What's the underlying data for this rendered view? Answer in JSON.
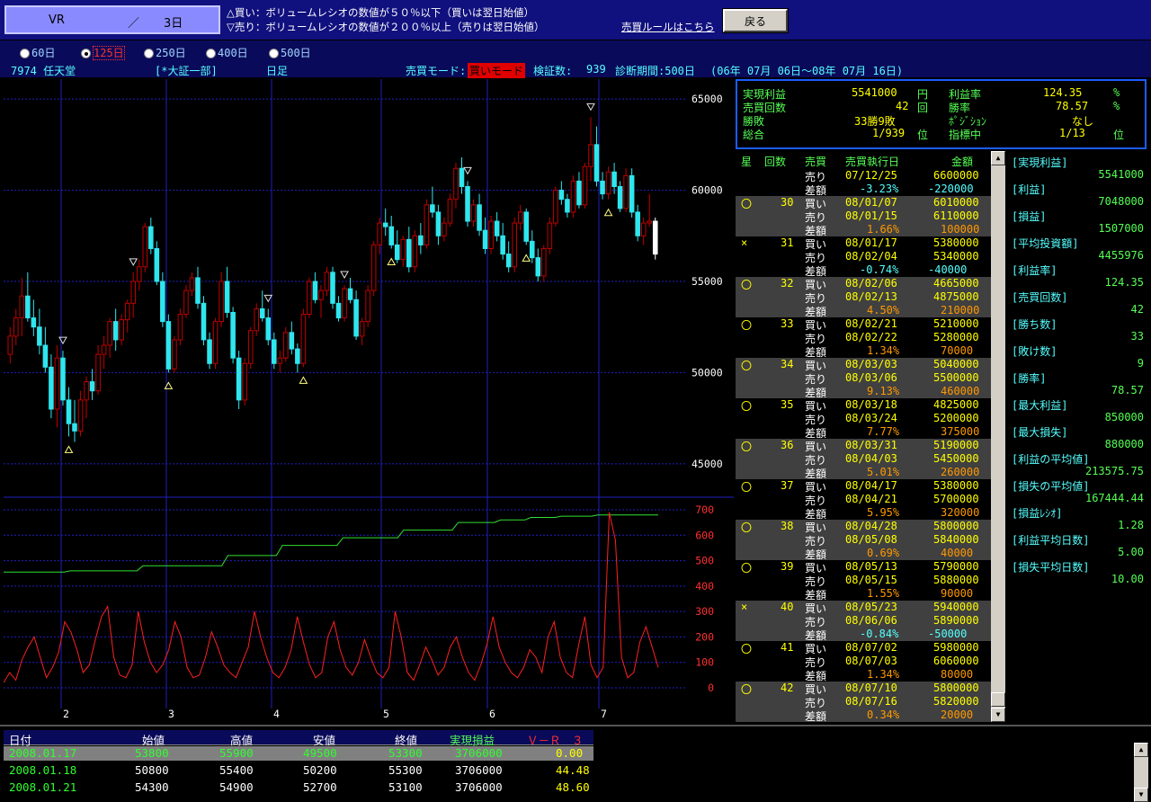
{
  "header": {
    "indicator": "VR",
    "slash": "／",
    "days": "3日",
    "buy_rule": "△買い：ボリュームレシオの数値が５０％以下（買いは翌日始値）",
    "sell_rule": "▽売り：ボリュームレシオの数値が２００％以上（売りは翌日始値）",
    "rules_link": "売買ルールはこちら",
    "back_label": "戻る"
  },
  "periods": [
    {
      "label": "60日",
      "selected": false
    },
    {
      "label": "125日",
      "selected": true
    },
    {
      "label": "250日",
      "selected": false
    },
    {
      "label": "400日",
      "selected": false
    },
    {
      "label": "500日",
      "selected": false
    }
  ],
  "stock": {
    "code_name": "7974 任天堂",
    "market": "[*大証一部]",
    "timeframe": "日足",
    "mode_label": "売買モード:",
    "mode_value": "買いモード",
    "verified_label": "検証数:",
    "verified_value": "939",
    "period_label": "診断期間:500日",
    "period_range": "(06年 07月 06日～08年 07月 16日)"
  },
  "summary": {
    "realized_label": "実現利益",
    "realized_value": "5541000",
    "realized_unit": "円",
    "trades_label": "売買回数",
    "trades_value": "42",
    "trades_unit": "回",
    "winloss_label": "勝敗",
    "winloss_value": "33勝9敗",
    "total_label": "総合",
    "total_value": "1/939",
    "total_unit": "位",
    "profit_rate_label": "利益率",
    "profit_rate_value": "124.35",
    "profit_rate_unit": "%",
    "win_rate_label": "勝率",
    "win_rate_value": "78.57",
    "win_rate_unit": "%",
    "position_label": "ﾎﾟｼﾞｼｮﾝ",
    "position_value": "なし",
    "indicator_label": "指標中",
    "indicator_value": "1/13",
    "indicator_unit": "位"
  },
  "trade_headers": [
    "星",
    "回数",
    "売買",
    "売買執行日",
    "金額"
  ],
  "trades_top": [
    {
      "side": "売り",
      "date": "07/12/25",
      "amount": "6600000"
    },
    {
      "side": "差額",
      "date": "-3.23%",
      "amount": "-220000"
    }
  ],
  "trades": [
    {
      "mark": "〇",
      "no": "30",
      "buy_date": "08/01/07",
      "buy_amt": "6010000",
      "sell_date": "08/01/15",
      "sell_amt": "6110000",
      "pct": "1.66%",
      "diff": "100000",
      "neg": false
    },
    {
      "mark": "×",
      "no": "31",
      "buy_date": "08/01/17",
      "buy_amt": "5380000",
      "sell_date": "08/02/04",
      "sell_amt": "5340000",
      "pct": "-0.74%",
      "diff": "-40000",
      "neg": true
    },
    {
      "mark": "〇",
      "no": "32",
      "buy_date": "08/02/06",
      "buy_amt": "4665000",
      "sell_date": "08/02/13",
      "sell_amt": "4875000",
      "pct": "4.50%",
      "diff": "210000",
      "neg": false
    },
    {
      "mark": "〇",
      "no": "33",
      "buy_date": "08/02/21",
      "buy_amt": "5210000",
      "sell_date": "08/02/22",
      "sell_amt": "5280000",
      "pct": "1.34%",
      "diff": "70000",
      "neg": false
    },
    {
      "mark": "〇",
      "no": "34",
      "buy_date": "08/03/03",
      "buy_amt": "5040000",
      "sell_date": "08/03/06",
      "sell_amt": "5500000",
      "pct": "9.13%",
      "diff": "460000",
      "neg": false
    },
    {
      "mark": "〇",
      "no": "35",
      "buy_date": "08/03/18",
      "buy_amt": "4825000",
      "sell_date": "08/03/24",
      "sell_amt": "5200000",
      "pct": "7.77%",
      "diff": "375000",
      "neg": false
    },
    {
      "mark": "〇",
      "no": "36",
      "buy_date": "08/03/31",
      "buy_amt": "5190000",
      "sell_date": "08/04/03",
      "sell_amt": "5450000",
      "pct": "5.01%",
      "diff": "260000",
      "neg": false
    },
    {
      "mark": "〇",
      "no": "37",
      "buy_date": "08/04/17",
      "buy_amt": "5380000",
      "sell_date": "08/04/21",
      "sell_amt": "5700000",
      "pct": "5.95%",
      "diff": "320000",
      "neg": false
    },
    {
      "mark": "〇",
      "no": "38",
      "buy_date": "08/04/28",
      "buy_amt": "5800000",
      "sell_date": "08/05/08",
      "sell_amt": "5840000",
      "pct": "0.69%",
      "diff": "40000",
      "neg": false
    },
    {
      "mark": "〇",
      "no": "39",
      "buy_date": "08/05/13",
      "buy_amt": "5790000",
      "sell_date": "08/05/15",
      "sell_amt": "5880000",
      "pct": "1.55%",
      "diff": "90000",
      "neg": false
    },
    {
      "mark": "×",
      "no": "40",
      "buy_date": "08/05/23",
      "buy_amt": "5940000",
      "sell_date": "08/06/06",
      "sell_amt": "5890000",
      "pct": "-0.84%",
      "diff": "-50000",
      "neg": true
    },
    {
      "mark": "〇",
      "no": "41",
      "buy_date": "08/07/02",
      "buy_amt": "5980000",
      "sell_date": "08/07/03",
      "sell_amt": "6060000",
      "pct": "1.34%",
      "diff": "80000",
      "neg": false
    },
    {
      "mark": "〇",
      "no": "42",
      "buy_date": "08/07/10",
      "buy_amt": "5800000",
      "sell_date": "08/07/16",
      "sell_amt": "5820000",
      "pct": "0.34%",
      "diff": "20000",
      "neg": false
    }
  ],
  "trade_words": {
    "buy": "買い",
    "sell": "売り",
    "diff": "差額"
  },
  "stats": [
    {
      "label": "[実現利益]",
      "value": "5541000"
    },
    {
      "label": "[利益]",
      "value": "7048000"
    },
    {
      "label": "[損益]",
      "value": "1507000"
    },
    {
      "label": "[平均投資額]",
      "value": "4455976"
    },
    {
      "label": "[利益率]",
      "value": "124.35"
    },
    {
      "label": "[売買回数]",
      "value": "42"
    },
    {
      "label": "[勝ち数]",
      "value": "33"
    },
    {
      "label": "[敗け数]",
      "value": "9"
    },
    {
      "label": "[勝率]",
      "value": "78.57"
    },
    {
      "label": "[最大利益]",
      "value": "850000"
    },
    {
      "label": "[最大損失]",
      "value": "880000"
    },
    {
      "label": "[利益の平均値]",
      "value": "213575.75"
    },
    {
      "label": "[損失の平均値]",
      "value": "167444.44"
    },
    {
      "label": "[損益ﾚｼｵ]",
      "value": "1.28"
    },
    {
      "label": "[利益平均日数]",
      "value": "5.00"
    },
    {
      "label": "[損失平均日数]",
      "value": "10.00"
    }
  ],
  "bottom": {
    "headers": [
      "日付",
      "始値",
      "高値",
      "安値",
      "終値",
      "実現損益",
      "Ｖ－Ｒ　３"
    ],
    "rows": [
      [
        "2008.01.17",
        "53800",
        "55900",
        "49500",
        "53300",
        "3706000",
        "0.00"
      ],
      [
        "2008.01.18",
        "50800",
        "55400",
        "50200",
        "55300",
        "3706000",
        "44.48"
      ],
      [
        "2008.01.21",
        "54300",
        "54900",
        "52700",
        "53100",
        "3706000",
        "48.60"
      ]
    ]
  },
  "colors": {
    "up": "#c00000",
    "down": "#2ee6ee",
    "grid": "#2020c0",
    "vr_line": "#ff2020",
    "profit_line": "#30e030",
    "label_green": "#55ff55",
    "label_cyan": "#55ffff",
    "diff_orange": "#ff9900",
    "neg_cyan": "#55ffff"
  },
  "chart_data": {
    "type": "candlestick+line",
    "price_axis": {
      "ticks": [
        "65000",
        "60000",
        "55000",
        "50000",
        "45000"
      ],
      "ylim": [
        44500,
        65500
      ]
    },
    "vr_axis": {
      "ticks": [
        "700",
        "600",
        "500",
        "400",
        "300",
        "200",
        "100",
        "0"
      ],
      "ylim": [
        0,
        700
      ]
    },
    "x_ticks": [
      "2",
      "3",
      "4",
      "5",
      "6",
      "7"
    ],
    "candles_ohlc": [
      [
        51000,
        52500,
        50500,
        52000
      ],
      [
        52000,
        53500,
        51500,
        53000
      ],
      [
        53000,
        55200,
        52000,
        54200
      ],
      [
        54200,
        55500,
        52800,
        53000
      ],
      [
        53000,
        54000,
        52000,
        52500
      ],
      [
        52500,
        53500,
        51000,
        51500
      ],
      [
        51500,
        52500,
        50000,
        50300
      ],
      [
        50300,
        51000,
        47500,
        48000
      ],
      [
        48000,
        51500,
        47000,
        50800
      ],
      [
        50800,
        51200,
        48200,
        48500
      ],
      [
        48500,
        49200,
        46500,
        47200
      ],
      [
        47200,
        48500,
        46200,
        46800
      ],
      [
        46800,
        49000,
        46500,
        48500
      ],
      [
        48500,
        49800,
        47500,
        49500
      ],
      [
        49500,
        50200,
        48500,
        49000
      ],
      [
        49000,
        51500,
        48800,
        51000
      ],
      [
        51000,
        52000,
        50200,
        51500
      ],
      [
        51500,
        53000,
        50800,
        52800
      ],
      [
        52800,
        53500,
        51200,
        51800
      ],
      [
        51800,
        53200,
        51500,
        52900
      ],
      [
        52900,
        54000,
        52200,
        53800
      ],
      [
        53800,
        55500,
        53000,
        55000
      ],
      [
        55000,
        56200,
        54500,
        55800
      ],
      [
        55800,
        58200,
        55500,
        58000
      ],
      [
        58000,
        58500,
        56500,
        56800
      ],
      [
        56800,
        57200,
        54800,
        55000
      ],
      [
        55000,
        55500,
        52500,
        52800
      ],
      [
        52800,
        53200,
        50000,
        50200
      ],
      [
        50200,
        52000,
        50000,
        51800
      ],
      [
        51800,
        53500,
        51500,
        53200
      ],
      [
        53200,
        54800,
        53000,
        54500
      ],
      [
        54500,
        55500,
        54200,
        55200
      ],
      [
        55200,
        55800,
        53500,
        53800
      ],
      [
        53800,
        54200,
        51500,
        51800
      ],
      [
        51800,
        52200,
        50200,
        50500
      ],
      [
        50500,
        53000,
        50200,
        52800
      ],
      [
        52800,
        55500,
        52500,
        55000
      ],
      [
        55000,
        55800,
        53000,
        53300
      ],
      [
        53300,
        53600,
        50500,
        50800
      ],
      [
        50800,
        51200,
        48000,
        48500
      ],
      [
        48500,
        50800,
        48200,
        50500
      ],
      [
        50500,
        52500,
        50200,
        52300
      ],
      [
        52300,
        53800,
        52000,
        53500
      ],
      [
        53500,
        54500,
        52800,
        53000
      ],
      [
        53000,
        53500,
        51500,
        51800
      ],
      [
        51800,
        52200,
        50200,
        50500
      ],
      [
        50500,
        51200,
        50000,
        50800
      ],
      [
        50800,
        52500,
        50600,
        52200
      ],
      [
        52200,
        52800,
        51000,
        51300
      ],
      [
        51300,
        51600,
        50000,
        50500
      ],
      [
        50500,
        53500,
        50300,
        53200
      ],
      [
        53200,
        55200,
        53000,
        55000
      ],
      [
        55000,
        55500,
        53800,
        54000
      ],
      [
        54000,
        54800,
        53000,
        54500
      ],
      [
        54500,
        55800,
        54200,
        55500
      ],
      [
        55500,
        55800,
        53500,
        53800
      ],
      [
        53800,
        54200,
        52800,
        53000
      ],
      [
        53000,
        54800,
        52800,
        54600
      ],
      [
        54600,
        55200,
        53800,
        54000
      ],
      [
        54000,
        54500,
        51800,
        52000
      ],
      [
        52000,
        53000,
        51500,
        52800
      ],
      [
        52800,
        54800,
        52500,
        54500
      ],
      [
        54500,
        57200,
        54200,
        57000
      ],
      [
        57000,
        58500,
        56500,
        58200
      ],
      [
        58200,
        59000,
        57500,
        58000
      ],
      [
        58000,
        58600,
        56800,
        57000
      ],
      [
        57000,
        57800,
        56000,
        56200
      ],
      [
        56200,
        57500,
        55800,
        57300
      ],
      [
        57300,
        58000,
        55500,
        55800
      ],
      [
        55800,
        57800,
        55500,
        57500
      ],
      [
        57500,
        58200,
        56500,
        57000
      ],
      [
        57000,
        59500,
        56800,
        59200
      ],
      [
        59200,
        60200,
        58500,
        58800
      ],
      [
        58800,
        59200,
        57000,
        57500
      ],
      [
        57500,
        58500,
        57200,
        58200
      ],
      [
        58200,
        59800,
        58000,
        59500
      ],
      [
        59500,
        61500,
        59000,
        61200
      ],
      [
        61200,
        61800,
        59800,
        60200
      ],
      [
        60200,
        60500,
        58000,
        58300
      ],
      [
        58300,
        59500,
        58000,
        59200
      ],
      [
        59200,
        59800,
        57500,
        57800
      ],
      [
        57800,
        58500,
        56500,
        56800
      ],
      [
        56800,
        58600,
        56500,
        58300
      ],
      [
        58300,
        58800,
        57200,
        57500
      ],
      [
        57500,
        58200,
        56200,
        56500
      ],
      [
        56500,
        57200,
        55500,
        55800
      ],
      [
        55800,
        58500,
        55500,
        58200
      ],
      [
        58200,
        59200,
        57800,
        58800
      ],
      [
        58800,
        59000,
        57000,
        57200
      ],
      [
        57200,
        57800,
        56000,
        56300
      ],
      [
        56300,
        56800,
        55000,
        55300
      ],
      [
        55300,
        57000,
        55000,
        56800
      ],
      [
        56800,
        58500,
        56500,
        58200
      ],
      [
        58200,
        60200,
        58000,
        60000
      ],
      [
        60000,
        60500,
        59200,
        59500
      ],
      [
        59500,
        59800,
        58500,
        58800
      ],
      [
        58800,
        60800,
        58500,
        60500
      ],
      [
        60500,
        61000,
        59000,
        59200
      ],
      [
        59200,
        61500,
        59000,
        61300
      ],
      [
        61300,
        64000,
        60500,
        62500
      ],
      [
        62500,
        63500,
        60200,
        60500
      ],
      [
        60500,
        61000,
        59500,
        59800
      ],
      [
        59800,
        61300,
        59500,
        61000
      ],
      [
        61000,
        61500,
        59800,
        60200
      ],
      [
        60200,
        60500,
        58800,
        59000
      ],
      [
        59000,
        61200,
        58800,
        60800
      ],
      [
        60800,
        61200,
        58500,
        58800
      ],
      [
        58800,
        59200,
        57200,
        57500
      ],
      [
        57500,
        58500,
        57000,
        58200
      ],
      [
        58200,
        59800,
        58000,
        58300
      ],
      [
        58300,
        58500,
        56200,
        56500
      ]
    ],
    "buy_signals_idx": [
      10,
      27,
      50,
      65,
      88,
      102
    ],
    "sell_signals_idx": [
      9,
      21,
      44,
      57,
      78,
      99
    ],
    "vr_values": [
      20,
      60,
      30,
      110,
      160,
      200,
      120,
      40,
      80,
      140,
      260,
      220,
      150,
      60,
      90,
      190,
      280,
      320,
      120,
      50,
      40,
      90,
      300,
      180,
      100,
      60,
      90,
      150,
      260,
      200,
      80,
      40,
      50,
      120,
      220,
      160,
      90,
      60,
      40,
      100,
      160,
      300,
      200,
      120,
      60,
      40,
      80,
      150,
      280,
      180,
      90,
      40,
      60,
      200,
      260,
      150,
      80,
      50,
      100,
      190,
      120,
      60,
      40,
      80,
      300,
      200,
      60,
      30,
      90,
      160,
      110,
      50,
      80,
      160,
      200,
      120,
      60,
      30,
      90,
      170,
      280,
      160,
      100,
      60,
      40,
      80,
      150,
      120,
      60,
      200,
      260,
      120,
      60,
      40,
      170,
      280,
      90,
      40,
      80,
      690,
      580,
      120,
      40,
      60,
      180,
      240,
      160,
      80
    ],
    "profit_line": [
      455,
      455,
      455,
      455,
      455,
      455,
      455,
      455,
      455,
      455,
      455,
      460,
      460,
      460,
      460,
      460,
      460,
      460,
      460,
      460,
      460,
      460,
      460,
      480,
      480,
      480,
      480,
      480,
      480,
      480,
      480,
      480,
      480,
      480,
      480,
      480,
      480,
      520,
      520,
      520,
      520,
      520,
      520,
      520,
      520,
      520,
      560,
      560,
      560,
      560,
      560,
      560,
      560,
      560,
      560,
      560,
      590,
      590,
      590,
      590,
      590,
      590,
      590,
      590,
      590,
      590,
      620,
      620,
      620,
      620,
      620,
      620,
      620,
      620,
      620,
      650,
      650,
      650,
      650,
      650,
      650,
      650,
      660,
      660,
      660,
      660,
      660,
      670,
      670,
      670,
      670,
      670,
      675,
      675,
      675,
      675,
      675,
      675,
      680,
      680,
      680,
      680,
      680,
      680,
      680,
      680,
      680,
      680,
      680
    ]
  }
}
